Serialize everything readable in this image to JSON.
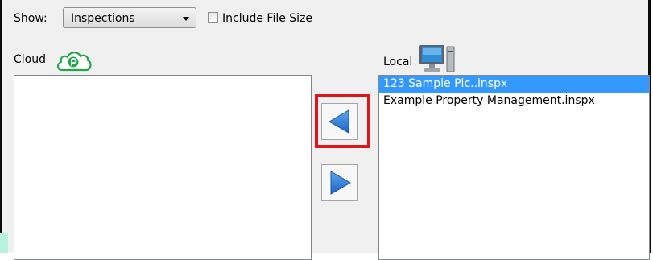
{
  "toolbar": {
    "show_label": "Show:",
    "show_select_value": "Inspections",
    "include_file_size_label": "Include File Size",
    "include_file_size_checked": false
  },
  "cloud": {
    "label": "Cloud",
    "icon": "cloud-icon",
    "items": []
  },
  "local": {
    "label": "Local",
    "icon": "computer-icon",
    "items": [
      {
        "label": "123 Sample Plc..inspx",
        "selected": true
      },
      {
        "label": "Example Property Management.inspx",
        "selected": false
      }
    ]
  },
  "transfer": {
    "left_icon": "arrow-left-icon",
    "right_icon": "arrow-right-icon"
  },
  "colors": {
    "selection": "#3399ff",
    "arrow_blue": "#2d78d6",
    "highlight": "#e0141d",
    "cloud_green": "#23a64a"
  }
}
